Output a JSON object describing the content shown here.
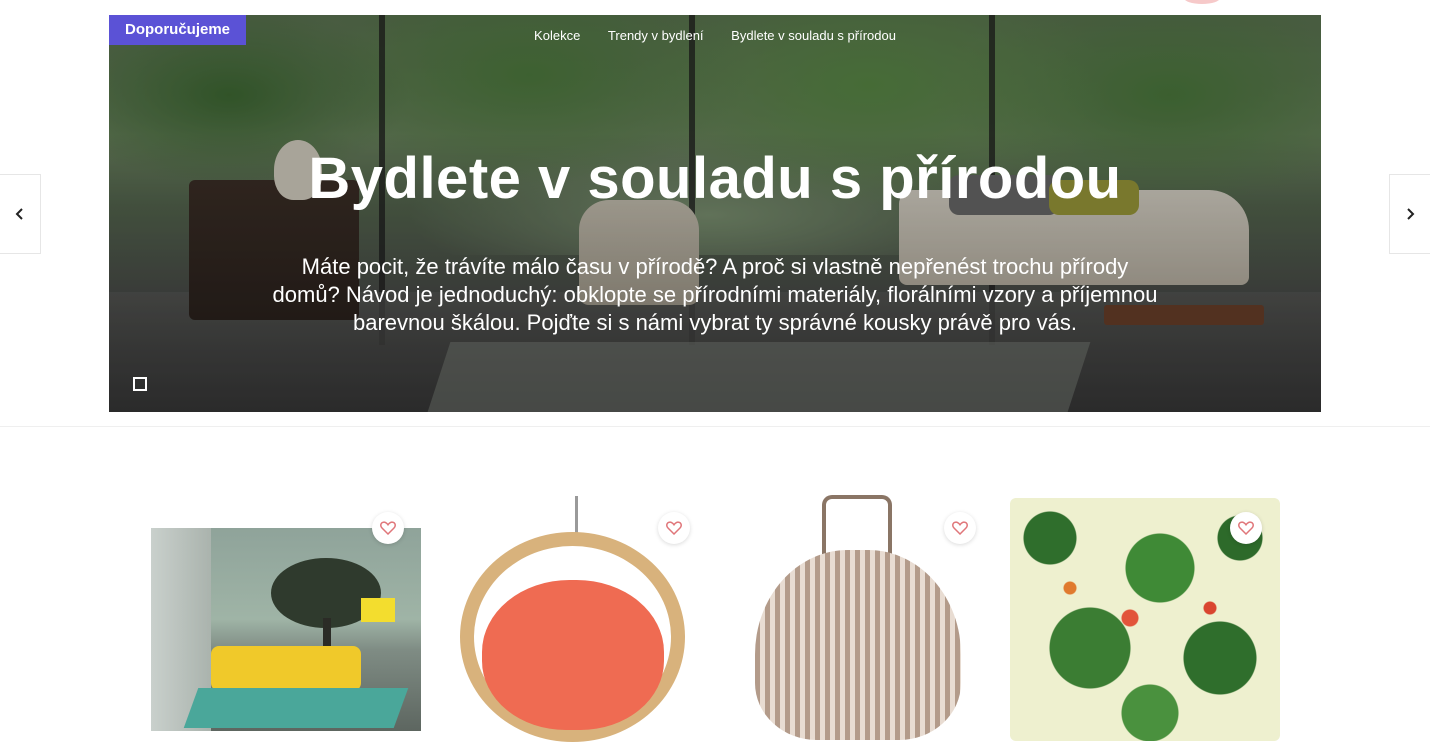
{
  "hero": {
    "badge": "Doporučujeme",
    "breadcrumb": [
      "Kolekce",
      "Trendy v bydlení",
      "Bydlete v souladu s přírodou"
    ],
    "title": "Bydlete v souladu s přírodou",
    "description": "Máte pocit, že trávíte málo času v přírodě? A proč si vlastně nepřenést trochu přírody domů? Návod je jednoduchý: obklopte se přírodními materiály, florálními vzory a příjemnou barevnou škálou. Pojďte si s námi vybrat ty správné kousky právě pro vás."
  },
  "carousel": {
    "prev_icon": "chevron-left-icon",
    "next_icon": "chevron-right-icon"
  },
  "products": [
    {
      "image": "tree-wallpaper-living-room",
      "favorite_icon": "heart-icon"
    },
    {
      "image": "hanging-wooden-egg-chair",
      "favorite_icon": "heart-icon"
    },
    {
      "image": "rattan-lantern",
      "favorite_icon": "heart-icon"
    },
    {
      "image": "tropical-leaf-pillow",
      "favorite_icon": "heart-icon"
    }
  ],
  "colors": {
    "badge": "#5b52d6",
    "heart": "#e0767a",
    "text_on_hero": "#ffffff"
  }
}
